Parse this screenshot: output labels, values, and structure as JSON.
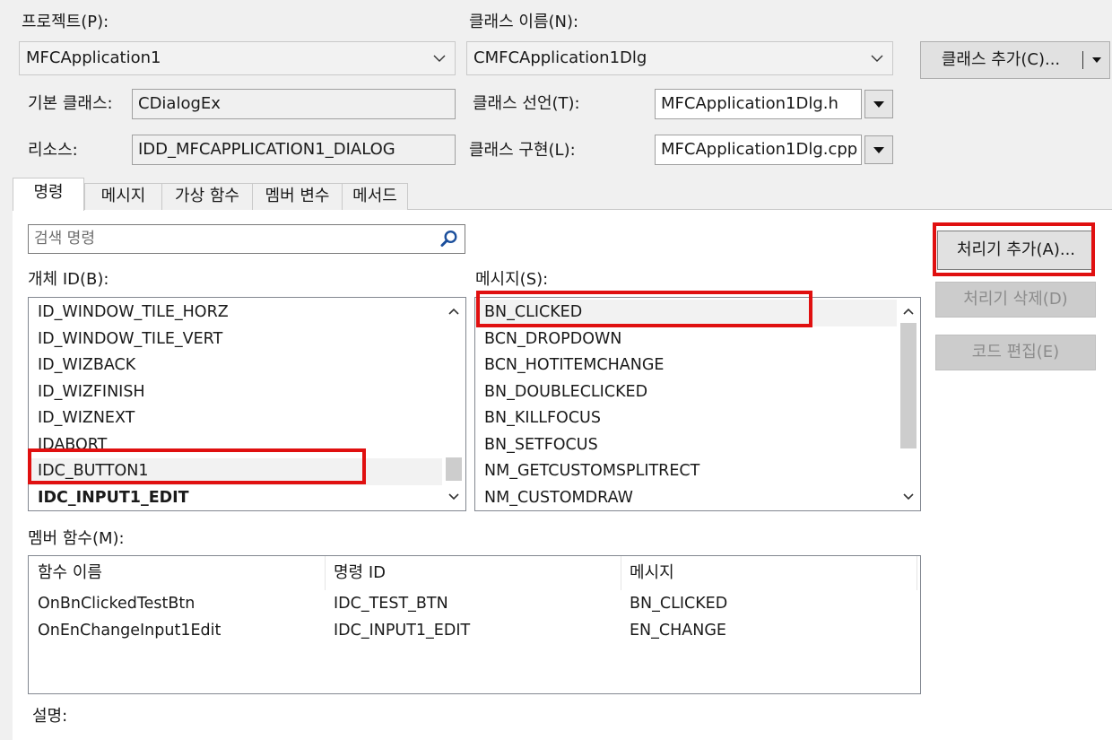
{
  "project": {
    "label": "프로젝트(P):",
    "value": "MFCApplication1"
  },
  "class_name": {
    "label": "클래스 이름(N):",
    "value": "CMFCApplication1Dlg"
  },
  "add_class_button": {
    "label": "클래스 추가(C)..."
  },
  "base_class": {
    "label": "기본 클래스:",
    "value": "CDialogEx"
  },
  "resource": {
    "label": "리소스:",
    "value": "IDD_MFCAPPLICATION1_DIALOG"
  },
  "class_declaration": {
    "label": "클래스 선언(T):",
    "value": "MFCApplication1Dlg.h"
  },
  "class_implementation": {
    "label": "클래스 구현(L):",
    "value": "MFCApplication1Dlg.cpp"
  },
  "tabs": [
    {
      "label": "명령",
      "active": true
    },
    {
      "label": "메시지"
    },
    {
      "label": "가상 함수"
    },
    {
      "label": "멤버 변수"
    },
    {
      "label": "메서드"
    }
  ],
  "search": {
    "placeholder": "검색 명령"
  },
  "object_ids": {
    "label": "개체 ID(B):",
    "items": [
      {
        "text": "ID_WINDOW_TILE_HORZ"
      },
      {
        "text": "ID_WINDOW_TILE_VERT"
      },
      {
        "text": "ID_WIZBACK"
      },
      {
        "text": "ID_WIZFINISH"
      },
      {
        "text": "ID_WIZNEXT"
      },
      {
        "text": "IDABORT"
      },
      {
        "text": "IDC_BUTTON1",
        "selected": true
      },
      {
        "text": "IDC_INPUT1_EDIT",
        "bold": true
      }
    ]
  },
  "messages": {
    "label": "메시지(S):",
    "items": [
      {
        "text": "BN_CLICKED",
        "selected": true
      },
      {
        "text": "BCN_DROPDOWN"
      },
      {
        "text": "BCN_HOTITEMCHANGE"
      },
      {
        "text": "BN_DOUBLECLICKED"
      },
      {
        "text": "BN_KILLFOCUS"
      },
      {
        "text": "BN_SETFOCUS"
      },
      {
        "text": "NM_GETCUSTOMSPLITRECT"
      },
      {
        "text": "NM_CUSTOMDRAW"
      }
    ]
  },
  "buttons": {
    "add_handler": "처리기 추가(A)...",
    "delete_handler": "처리기 삭제(D)",
    "edit_code": "코드 편집(E)"
  },
  "member_functions": {
    "label": "멤버 함수(M):",
    "columns": [
      "함수 이름",
      "명령 ID",
      "메시지"
    ],
    "rows": [
      [
        "OnBnClickedTestBtn",
        "IDC_TEST_BTN",
        "BN_CLICKED"
      ],
      [
        "OnEnChangeInput1Edit",
        "IDC_INPUT1_EDIT",
        "EN_CHANGE"
      ]
    ]
  },
  "description": {
    "label": "설명:"
  },
  "colors": {
    "highlight": "#e01010",
    "disabled_button": "#cccccc",
    "panel": "#ffffff",
    "dialog": "#f0f0f0"
  },
  "icons": [
    "chevron-down-icon",
    "dropdown-arrow-icon",
    "search-icon",
    "scroll-up-icon",
    "scroll-down-icon"
  ]
}
